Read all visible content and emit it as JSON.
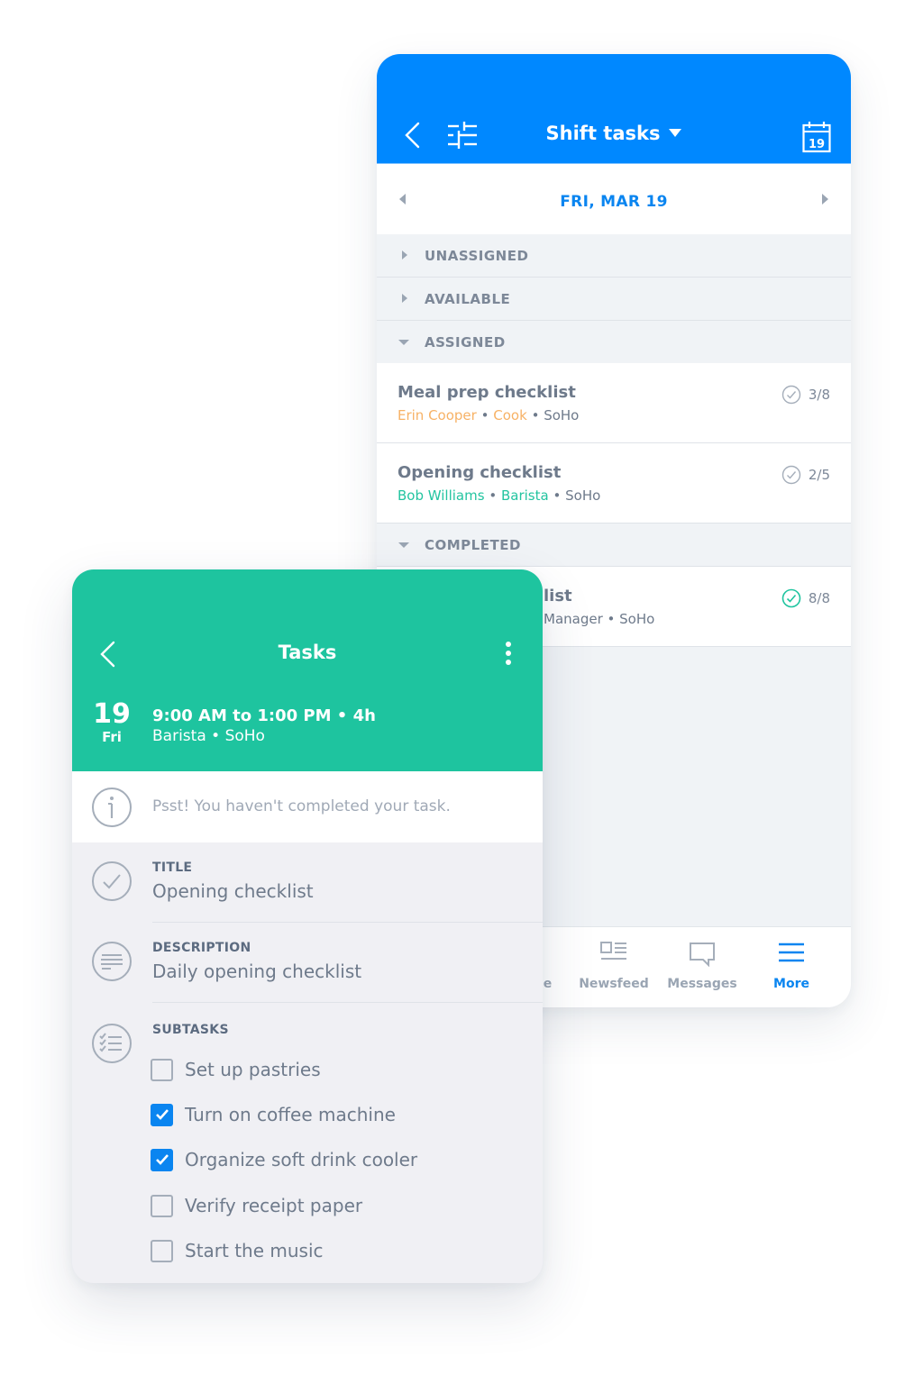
{
  "shift_tasks_screen": {
    "header": {
      "title": "Shift tasks",
      "back_icon": "chevron-left-icon",
      "filter_icon": "sliders-icon",
      "calendar_icon": "calendar-icon",
      "calendar_day": "19"
    },
    "date_nav": {
      "label": "FRI, MAR 19",
      "prev_icon": "triangle-left-icon",
      "next_icon": "triangle-right-icon"
    },
    "sections": [
      {
        "label": "UNASSIGNED",
        "expanded": false
      },
      {
        "label": "AVAILABLE",
        "expanded": false
      },
      {
        "label": "ASSIGNED",
        "expanded": true
      },
      {
        "label": "COMPLETED",
        "expanded": true
      }
    ],
    "assigned_tasks": [
      {
        "title": "Meal prep checklist",
        "person": "Erin Cooper",
        "role": "Cook",
        "location": "SoHo",
        "progress": "3/8",
        "color": "#f7b266"
      },
      {
        "title": "Opening checklist",
        "person": "Bob Williams",
        "role": "Barista",
        "location": "SoHo",
        "progress": "2/5",
        "color": "#23c4a0"
      }
    ],
    "completed_tasks": [
      {
        "title_visible": "list",
        "subtitle_visible": "Manager • SoHo",
        "progress": "8/8"
      }
    ],
    "separator": "•",
    "bottom_nav": [
      {
        "label": "le",
        "icon": "schedule-icon",
        "active": false
      },
      {
        "label": "Newsfeed",
        "icon": "newsfeed-icon",
        "active": false
      },
      {
        "label": "Messages",
        "icon": "message-icon",
        "active": false
      },
      {
        "label": "More",
        "icon": "menu-icon",
        "active": true
      }
    ]
  },
  "task_detail_screen": {
    "header": {
      "title": "Tasks",
      "back_icon": "chevron-left-icon",
      "more_icon": "kebab-menu-icon"
    },
    "shift": {
      "day_number": "19",
      "day_of_week": "Fri",
      "time": "9:00 AM to 1:00 PM • 4h",
      "role_location": "Barista • SoHo"
    },
    "alert": "Psst! You haven't completed your task.",
    "title_field": {
      "label": "TITLE",
      "value": "Opening checklist"
    },
    "description_field": {
      "label": "DESCRIPTION",
      "value": "Daily opening checklist"
    },
    "subtasks": {
      "label": "SUBTASKS",
      "items": [
        {
          "label": "Set up pastries",
          "checked": false
        },
        {
          "label": "Turn on coffee machine",
          "checked": true
        },
        {
          "label": "Organize soft drink cooler",
          "checked": true
        },
        {
          "label": "Verify receipt paper",
          "checked": false
        },
        {
          "label": "Start the music",
          "checked": false
        }
      ]
    }
  },
  "colors": {
    "blue_primary": "#0088ff",
    "green_primary": "#1ec49f",
    "orange_accent": "#f7b266",
    "teal_accent": "#23c4a0",
    "muted_text": "#6e7a8b"
  }
}
